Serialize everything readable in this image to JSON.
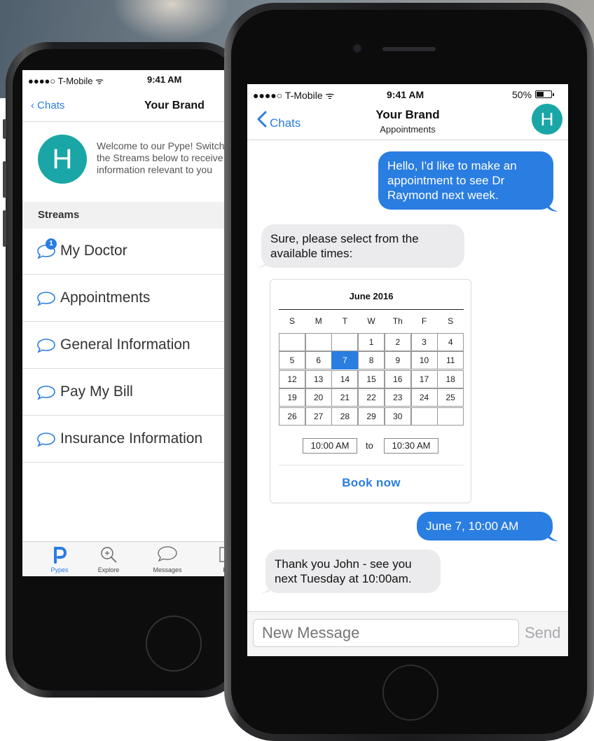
{
  "back_phone": {
    "status": {
      "carrier": "●●●●○ T-Mobile ᯤ",
      "time": "9:41 AM"
    },
    "nav": {
      "back": "Chats",
      "title": "Your Brand"
    },
    "avatar_letter": "H",
    "welcome": [
      "Welcome to our Pype! Switch",
      "the Streams below to receive",
      "information relevant to you"
    ],
    "streams_header": "Streams",
    "streams": [
      {
        "label": "My Doctor",
        "badge": "1"
      },
      {
        "label": "Appointments"
      },
      {
        "label": "General Information"
      },
      {
        "label": "Pay My Bill"
      },
      {
        "label": "Insurance Information"
      }
    ],
    "tabs": [
      {
        "label": "Pypes",
        "icon": "pype-logo-icon"
      },
      {
        "label": "Explore",
        "icon": "explore-magnifier-icon"
      },
      {
        "label": "Messages",
        "icon": "speech-bubble-icon"
      },
      {
        "label": "F",
        "icon": "profile-icon"
      }
    ]
  },
  "front_phone": {
    "status": {
      "carrier": "●●●●○ T-Mobile ᯤ",
      "time": "9:41 AM",
      "battery": "50%"
    },
    "nav": {
      "back": "Chats",
      "brand": "Your Brand",
      "subtitle": "Appointments",
      "avatar_letter": "H"
    },
    "messages": [
      {
        "dir": "out",
        "lines": [
          "Hello, I'd like to make an",
          "appointment to see Dr",
          "Raymond next week."
        ]
      },
      {
        "dir": "in",
        "lines": [
          "Sure, please select from the",
          "available times:"
        ]
      },
      {
        "dir": "out",
        "lines": [
          "June 7, 10:00 AM"
        ]
      },
      {
        "dir": "in",
        "lines": [
          "Thank you John - see you",
          "next Tuesday at 10:00am."
        ]
      }
    ],
    "calendar": {
      "month": "June 2016",
      "weekdays": [
        "S",
        "M",
        "T",
        "W",
        "Th",
        "F",
        "S"
      ],
      "weeks": [
        [
          "",
          "",
          "",
          "1",
          "2",
          "3",
          "4"
        ],
        [
          "5",
          "6",
          "7",
          "8",
          "9",
          "10",
          "11"
        ],
        [
          "12",
          "13",
          "14",
          "15",
          "16",
          "17",
          "18"
        ],
        [
          "19",
          "20",
          "21",
          "22",
          "23",
          "24",
          "25"
        ],
        [
          "26",
          "27",
          "28",
          "29",
          "30",
          "",
          ""
        ]
      ],
      "selected_day": "7",
      "start_time": "10:00 AM",
      "to_label": "to",
      "end_time": "10:30 AM",
      "book_label": "Book now"
    },
    "input": {
      "placeholder": "New Message",
      "send": "Send"
    }
  },
  "colors": {
    "accent": "#2a7de1",
    "avatar": "#1aa6a6",
    "incoming_bubble": "#ebebed"
  }
}
